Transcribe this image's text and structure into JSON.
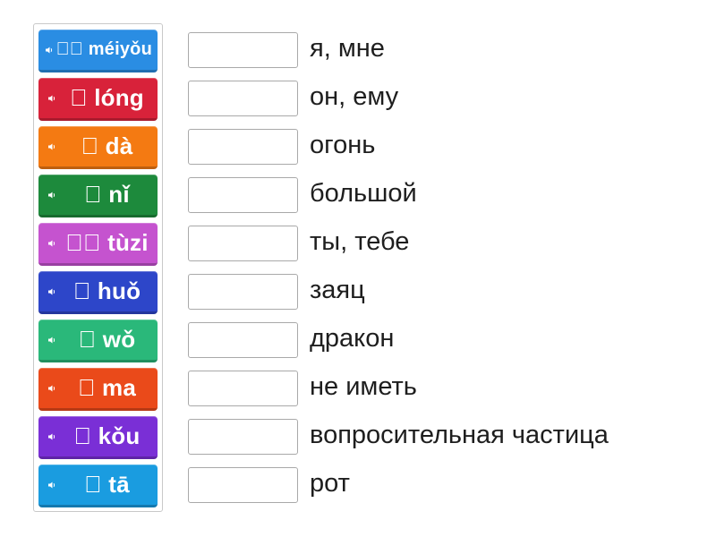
{
  "tiles": [
    {
      "label": "􏿾􏿾 méiyǒu",
      "color": "#2a8de3"
    },
    {
      "label": "􏿾 lóng",
      "color": "#d8223a"
    },
    {
      "label": "􏿾 dà",
      "color": "#f47a12"
    },
    {
      "label": "􏿾 nǐ",
      "color": "#1d8a3c"
    },
    {
      "label": "􏿾􏿾 tùzi",
      "color": "#c553cf"
    },
    {
      "label": "􏿾 huǒ",
      "color": "#2d46c9"
    },
    {
      "label": "􏿾 wǒ",
      "color": "#2ab87a"
    },
    {
      "label": "􏿾 ma",
      "color": "#ea4a1a"
    },
    {
      "label": "􏿾 kǒu",
      "color": "#7a2fd6"
    },
    {
      "label": "􏿾 tā",
      "color": "#1a9ce0"
    }
  ],
  "terms": [
    "я, мне",
    "он, ему",
    "огонь",
    "большой",
    "ты, тебе",
    "заяц",
    "дракон",
    "не иметь",
    "вопросительная частица",
    "рот"
  ],
  "icons": {
    "tile_audio": "speaker-icon"
  }
}
